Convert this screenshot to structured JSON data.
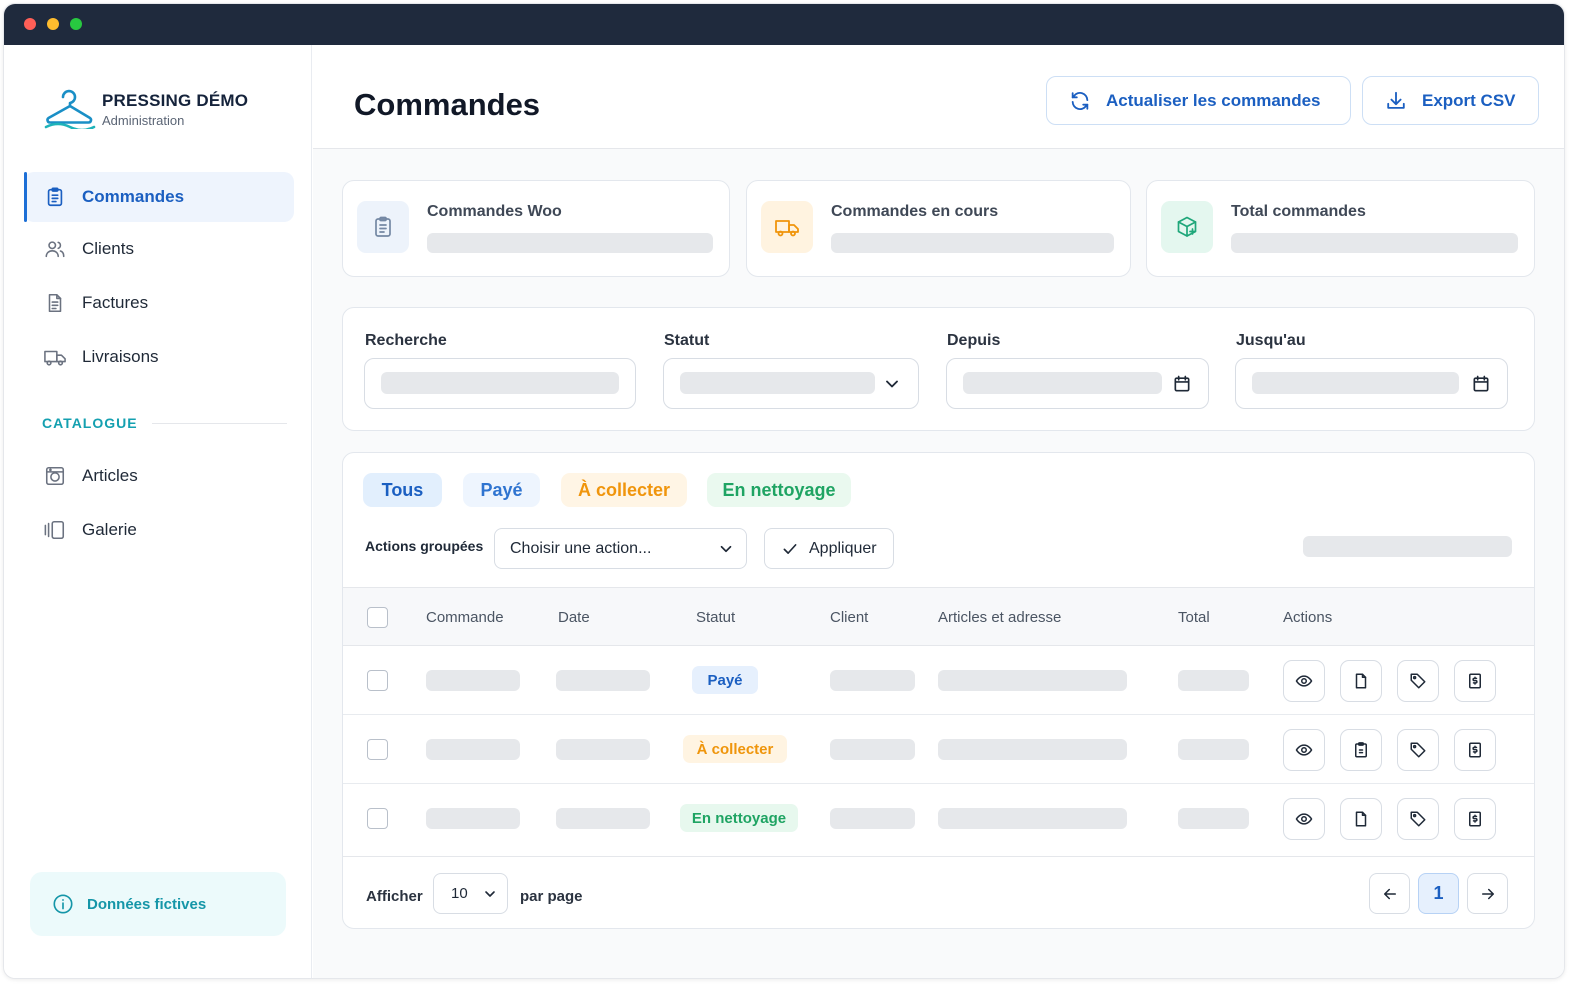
{
  "brand": {
    "name": "PRESSING DÉMO",
    "subtitle": "Administration"
  },
  "colors": {
    "accent": "#1b5fc1",
    "teal": "#14a0b0",
    "orange": "#f0950c",
    "green": "#1fa463",
    "titlebar": "#1f2a3d"
  },
  "sidebar": {
    "items": [
      {
        "label": "Commandes",
        "icon": "clipboard-list-icon",
        "active": true
      },
      {
        "label": "Clients",
        "icon": "users-icon",
        "active": false
      },
      {
        "label": "Factures",
        "icon": "document-icon",
        "active": false
      },
      {
        "label": "Livraisons",
        "icon": "truck-icon",
        "active": false
      }
    ],
    "catalogue_heading": "CATALOGUE",
    "catalogue_items": [
      {
        "label": "Articles",
        "icon": "washing-machine-icon"
      },
      {
        "label": "Galerie",
        "icon": "gallery-icon"
      }
    ],
    "demo_notice": "Données fictives"
  },
  "header": {
    "title": "Commandes",
    "refresh_label": "Actualiser les commandes",
    "export_label": "Export CSV"
  },
  "stats": [
    {
      "title": "Commandes Woo",
      "icon": "clipboard-icon"
    },
    {
      "title": "Commandes en cours",
      "icon": "truck-icon"
    },
    {
      "title": "Total commandes",
      "icon": "box-plus-icon"
    }
  ],
  "filters": {
    "search_label": "Recherche",
    "status_label": "Statut",
    "since_label": "Depuis",
    "until_label": "Jusqu'au"
  },
  "status_tabs": [
    "Tous",
    "Payé",
    "À collecter",
    "En nettoyage"
  ],
  "bulk": {
    "label": "Actions groupées",
    "select_value": "Choisir une action...",
    "apply_label": "Appliquer"
  },
  "table": {
    "columns": [
      "Commande",
      "Date",
      "Statut",
      "Client",
      "Articles et adresse",
      "Total",
      "Actions"
    ],
    "rows": [
      {
        "status": "Payé",
        "status_kind": "paye"
      },
      {
        "status": "À collecter",
        "status_kind": "collect"
      },
      {
        "status": "En nettoyage",
        "status_kind": "nettoy"
      }
    ],
    "row_actions": [
      "eye-icon",
      "document-icon",
      "tag-icon",
      "invoice-icon"
    ]
  },
  "pagination": {
    "show_label": "Afficher",
    "per_page_value": "10",
    "per_page_label": "par page",
    "current_page": "1"
  }
}
